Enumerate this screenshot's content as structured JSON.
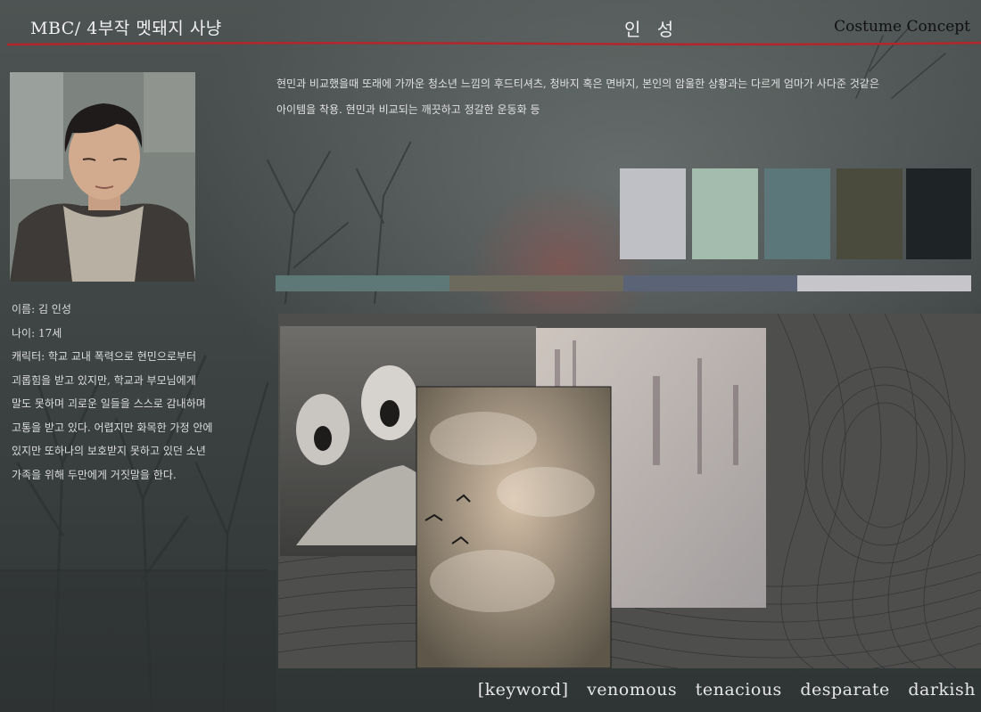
{
  "header": {
    "left_title": "MBC/ 4부작 멧돼지 사냥",
    "center_title": "인 성",
    "right_title": "Costume Concept"
  },
  "profile": {
    "name": "이름: 김 인성",
    "age": "나이: 17세",
    "character_lines": [
      "캐릭터: 학교 교내 폭력으로 현민으로부터",
      "괴롭힘을 받고 있지만, 학교과 부모님에게",
      "말도 못하며 괴로운 일들을 스스로 감내하며",
      "고통을 받고 있다. 어렵지만 화목한 가정 안에",
      "있지만 또하나의 보호받지 못하고 있던 소년",
      "가족을 위해 두만에게 거짓말을 한다."
    ]
  },
  "description": {
    "lines": [
      "현민과 비교했을때 또래에 가까운 청소년 느낌의 후드티셔츠, 청바지 혹은 면바지, 본인의 암울한 상황과는 다르게 엄마가 사다준 것같은",
      "아이템을 착용. 현민과 비교되는 깨끗하고 정갈한 운동화 등"
    ]
  },
  "palette": {
    "swatches": [
      "#bfc0c6",
      "#a3bcad",
      "#5b7779",
      "#4a4b3c",
      "#1e2426"
    ],
    "strip": [
      "#5e7877",
      "#6b6a5c",
      "#5a6476",
      "#c5c5ca"
    ]
  },
  "keywords": {
    "label": "[keyword]",
    "words": [
      "venomous",
      "tenacious",
      "desparate",
      "darkish"
    ]
  },
  "colors": {
    "accent_red": "#b3262b"
  }
}
